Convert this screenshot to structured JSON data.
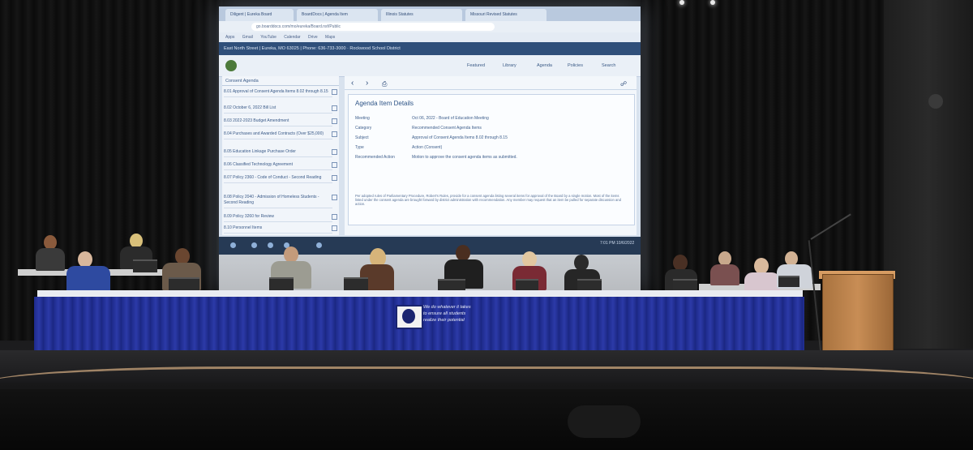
{
  "projection": {
    "tabs": [
      "Diligent | Eureka Board",
      "BoardDocs | Agenda Item",
      "Illinois Statutes",
      "Missouri Revised Statutes"
    ],
    "url": "go.boarddocs.com/mo/eureka/Board.nsf/Public",
    "bookmarks": [
      "Apps",
      "Gmail",
      "YouTube",
      "Calendar",
      "Drive",
      "Maps"
    ],
    "site_header": "East North Street | Eureka, MO 63025 | Phone: 636-733-3000 · Rockwood School District",
    "nav": [
      "Featured",
      "Library",
      "Agenda",
      "Policies",
      "Search"
    ],
    "sidebar_title": "Consent Agenda",
    "agenda_items": [
      "8.01 Approval of Consent Agenda Items 8.02 through 8.15",
      "8.02 October 6, 2022 Bill List",
      "8.03 2022-2023 Budget Amendment",
      "8.04 Purchases and Awarded Contracts (Over $25,000)",
      "8.05 Education Linkage Purchase Order",
      "8.06 Classified Technology Agreement",
      "8.07 Policy 2360 - Code of Conduct - Second Reading",
      "8.08 Policy 2040 - Admission of Homeless Students - Second Reading",
      "8.09 Policy 3260 for Review",
      "8.10 Personnel Items"
    ],
    "details_title": "Agenda Item Details",
    "details": [
      {
        "label": "Meeting",
        "value": "Oct 06, 2022 - Board of Education Meeting"
      },
      {
        "label": "Category",
        "value": "Recommended Consent Agenda Items"
      },
      {
        "label": "Subject",
        "value": "Approval of Consent Agenda Items 8.02 through 8.15"
      },
      {
        "label": "Type",
        "value": "Action (Consent)"
      },
      {
        "label": "Recommended Action",
        "value": "Motion to approve the consent agenda items as submitted."
      }
    ],
    "details_paragraph": "Per adopted rules of Parliamentary Procedure, Robert's Rules, provide for a consent agenda listing several items for approval of the Board by a single motion. Most of the items listed under the consent agenda are brought forward by district administration with recommendation. Any member may request that an item be pulled for separate discussion and action.",
    "taskbar_time": "7:01 PM 10/6/2022"
  },
  "dais": {
    "motto": "We do whatever it takes to ensure all students realize their potential"
  }
}
